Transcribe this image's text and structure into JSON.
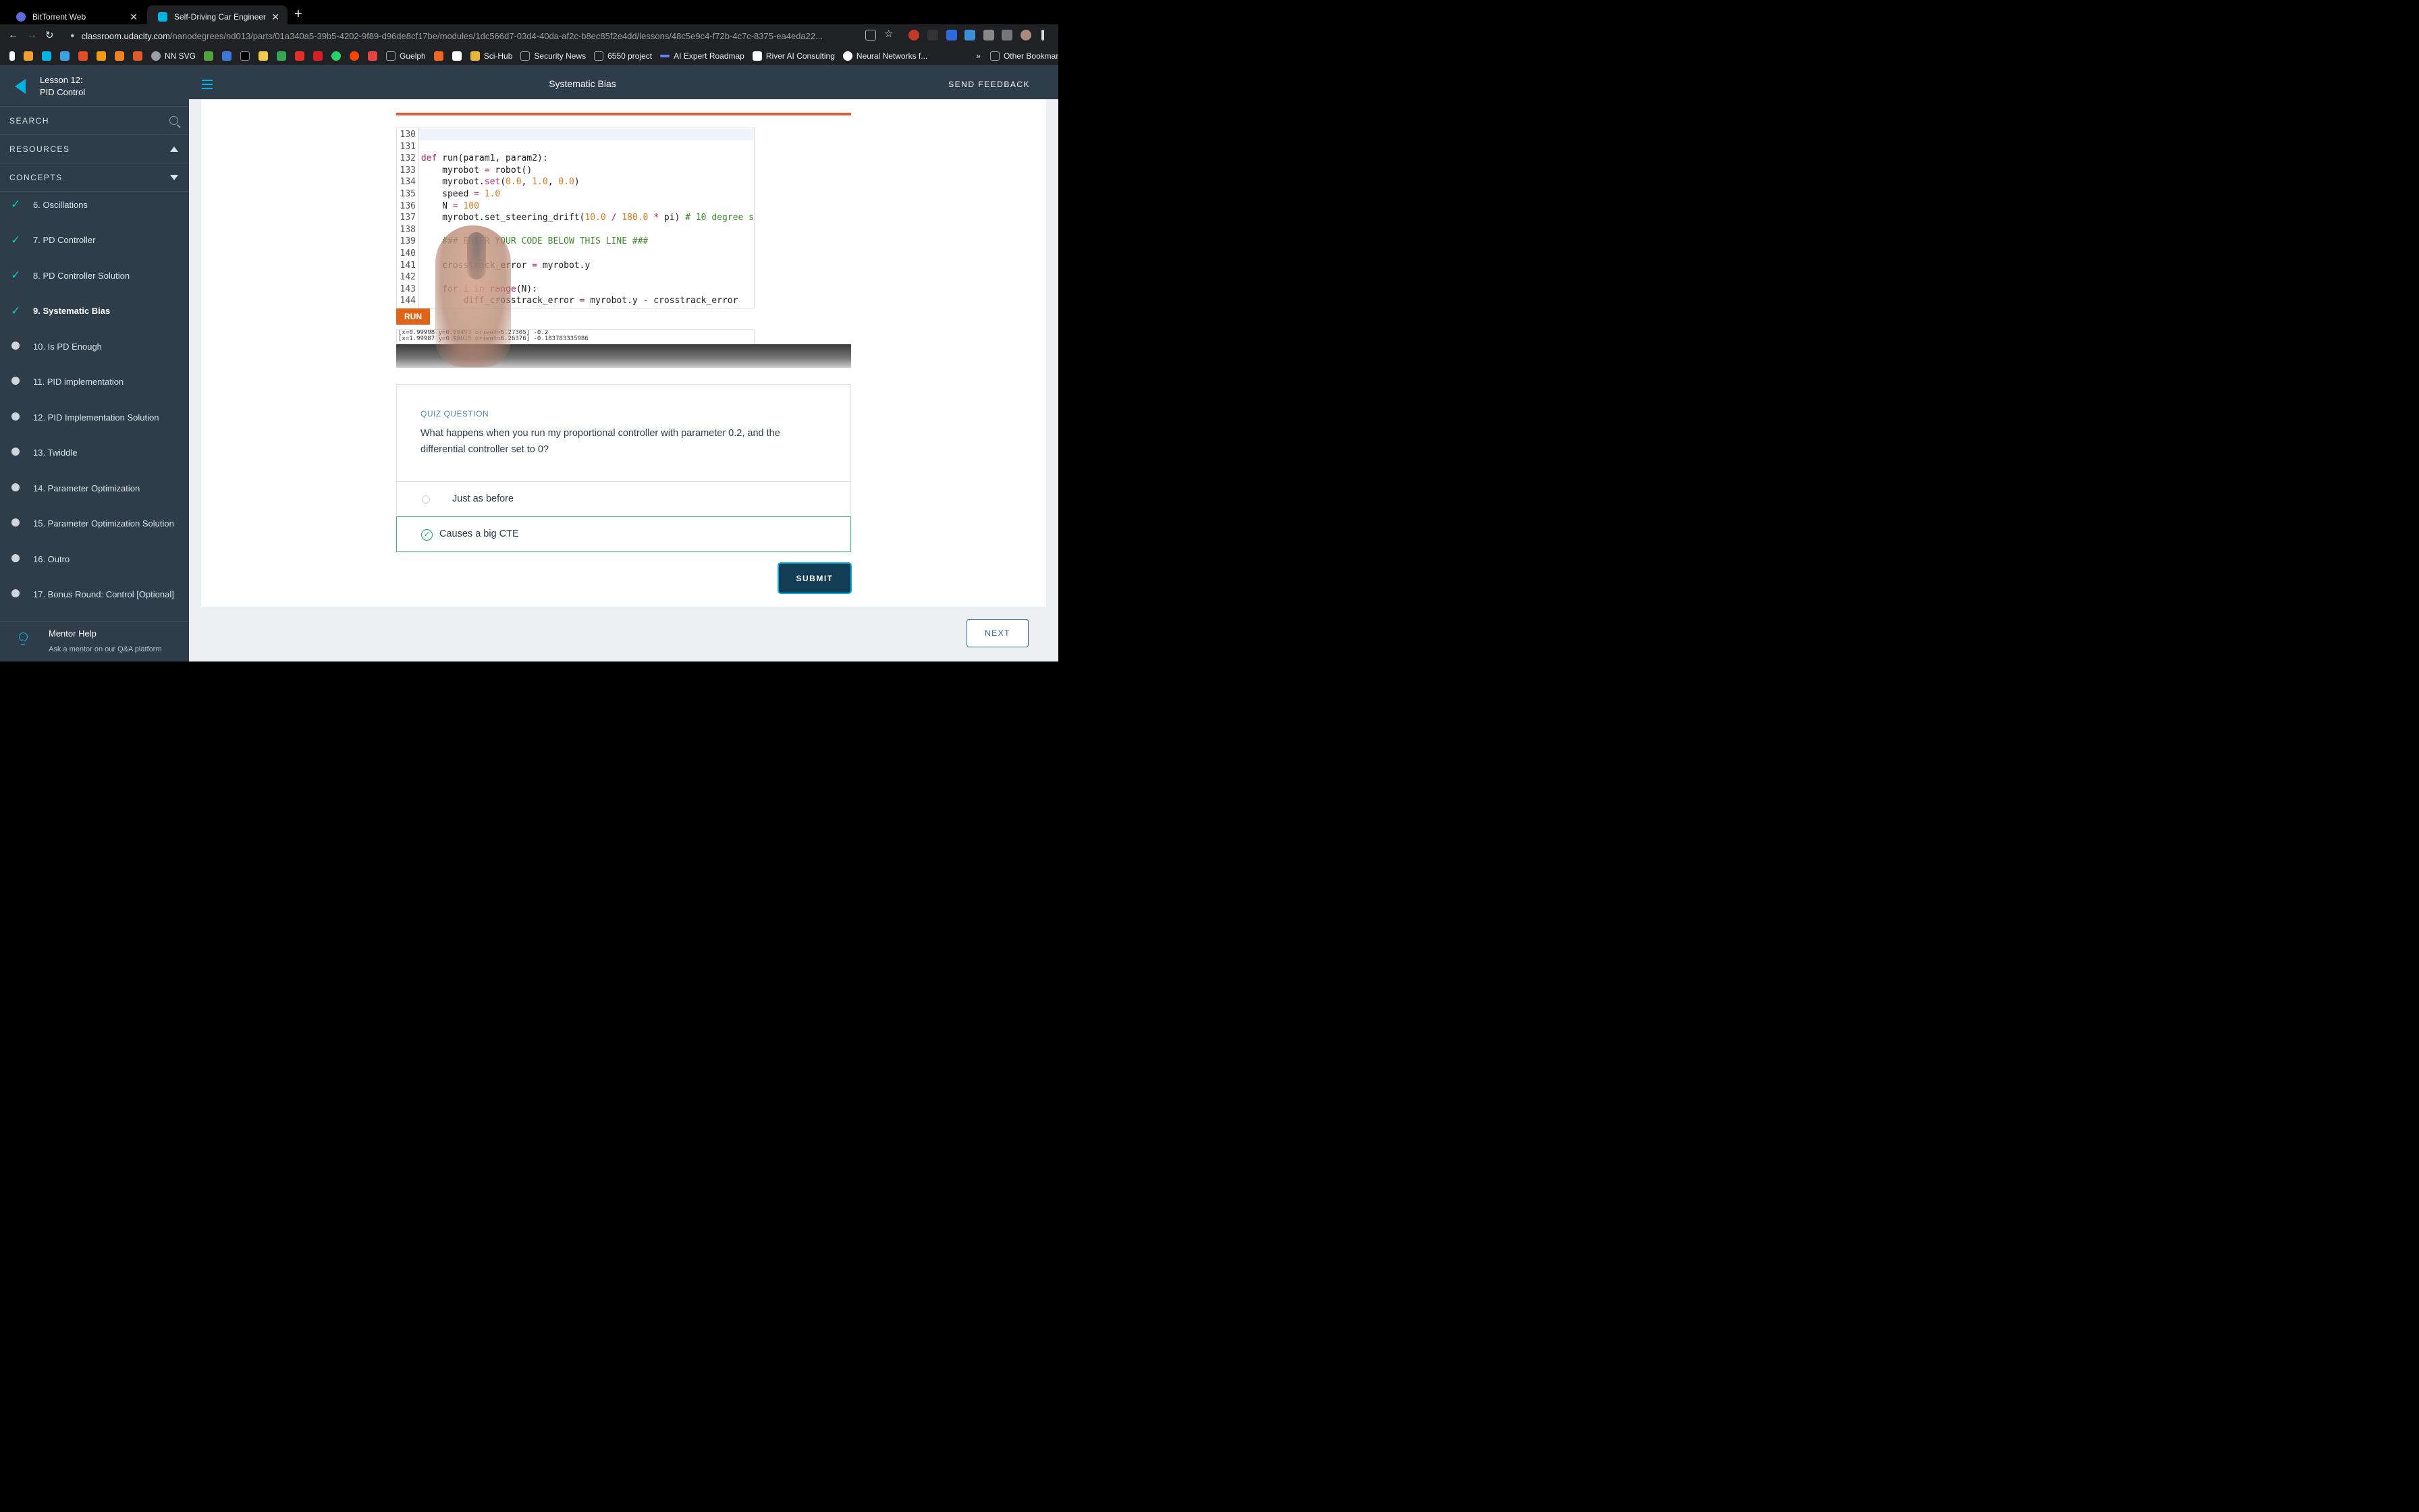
{
  "browser": {
    "tabs": [
      {
        "title": "BitTorrent Web",
        "close": "✕"
      },
      {
        "title": "Self-Driving Car Engineer",
        "close": "✕"
      }
    ],
    "new_tab": "+",
    "nav": {
      "back": "←",
      "forward": "→",
      "reload": "↻"
    },
    "url_host": "classroom.udacity.com",
    "url_path": "/nanodegrees/nd013/parts/01a340a5-39b5-4202-9f89-d96de8cf17be/modules/1dc566d7-03d4-40da-af2c-b8ec85f2e4dd/lessons/48c5e9c4-f72b-4c7c-8375-ea4eda22...",
    "bookmarks": [
      {
        "label": "NN SVG",
        "color": "#9aa0a6"
      },
      {
        "label": "Guelph",
        "color": "#9aa0a6"
      },
      {
        "label": "Sci-Hub",
        "color": "#e8b43a"
      },
      {
        "label": "Security News",
        "color": "#9aa0a6"
      },
      {
        "label": "6550 project",
        "color": "#9aa0a6"
      },
      {
        "label": "AI Expert Roadmap",
        "color": "#6b7cff"
      },
      {
        "label": "River AI Consulting",
        "color": "#ffffff"
      },
      {
        "label": "Neural Networks f...",
        "color": "#ffffff"
      }
    ],
    "bookmarks_more": "»",
    "other_bookmarks": "Other Bookmarks"
  },
  "sidebar": {
    "lesson_number": "Lesson 12:",
    "lesson_title": "PID Control",
    "search_label": "SEARCH",
    "resources_label": "RESOURCES",
    "concepts_label": "CONCEPTS",
    "concepts": [
      {
        "label": "6. Oscillations",
        "done": true
      },
      {
        "label": "7. PD Controller",
        "done": true
      },
      {
        "label": "8. PD Controller Solution",
        "done": true
      },
      {
        "label": "9. Systematic Bias",
        "done": true,
        "current": true
      },
      {
        "label": "10. Is PD Enough",
        "done": false
      },
      {
        "label": "11. PID implementation",
        "done": false
      },
      {
        "label": "12. PID Implementation Solution",
        "done": false
      },
      {
        "label": "13. Twiddle",
        "done": false
      },
      {
        "label": "14. Parameter Optimization",
        "done": false
      },
      {
        "label": "15. Parameter Optimization Solution",
        "done": false
      },
      {
        "label": "16. Outro",
        "done": false
      },
      {
        "label": "17. Bonus Round: Control [Optional]",
        "done": false
      }
    ],
    "mentor_title": "Mentor Help",
    "mentor_sub": "Ask a mentor on our Q&A platform"
  },
  "header": {
    "title": "Systematic Bias",
    "feedback": "SEND FEEDBACK"
  },
  "video": {
    "code_lines": [
      {
        "n": "130",
        "html": ""
      },
      {
        "n": "131",
        "html": ""
      },
      {
        "n": "132",
        "html": "<span class='kw'>def</span> run(param1, param2):"
      },
      {
        "n": "133",
        "html": "    myrobot <span class='op'>=</span> robot()"
      },
      {
        "n": "134",
        "html": "    myrobot.<span class='kw'>set</span>(<span class='num'>0.0</span>, <span class='num'>1.0</span>, <span class='num'>0.0</span>)"
      },
      {
        "n": "135",
        "html": "    speed <span class='op'>=</span> <span class='num'>1.0</span>"
      },
      {
        "n": "136",
        "html": "    N <span class='op'>=</span> <span class='num'>100</span>"
      },
      {
        "n": "137",
        "html": "    myrobot.set_steering_drift(<span class='num'>10.0</span> <span class='op'>/</span> <span class='num'>180.0</span> <span class='op'>*</span> pi) <span class='cm'># 10 degree s</span>"
      },
      {
        "n": "138",
        "html": ""
      },
      {
        "n": "139",
        "html": "    <span class='cm'>### ENTER YOUR CODE BELOW THIS LINE ###</span>"
      },
      {
        "n": "140",
        "html": ""
      },
      {
        "n": "141",
        "html": "    crosstrack_error <span class='op'>=</span> myrobot.y"
      },
      {
        "n": "142",
        "html": ""
      },
      {
        "n": "143",
        "html": "    <span class='kw'>for</span> i <span class='kw'>in</span> <span class='kw'>range</span>(N):"
      },
      {
        "n": "144",
        "html": "        diff_crosstrack_error <span class='op'>=</span> myrobot.y <span class='op'>-</span> crosstrack_error"
      }
    ],
    "run_label": "RUN",
    "output_lines": [
      "[x=0.99998 y=0.99493 orient=6.27305] -0.2",
      "[x=1.99987 y=0.98015 orient=6.26376] -0.183783335986"
    ]
  },
  "quiz": {
    "label": "QUIZ QUESTION",
    "question": "What happens when you run my proportional controller with parameter 0.2, and the differential controller set to 0?",
    "options": [
      {
        "label": "Just as before",
        "selected": false
      },
      {
        "label": "Causes a big CTE",
        "selected": true
      }
    ],
    "submit": "SUBMIT"
  },
  "next_label": "NEXT",
  "colors": {
    "accent": "#02b3e4",
    "sidebar": "#2e3d49",
    "correct": "#02b161"
  }
}
